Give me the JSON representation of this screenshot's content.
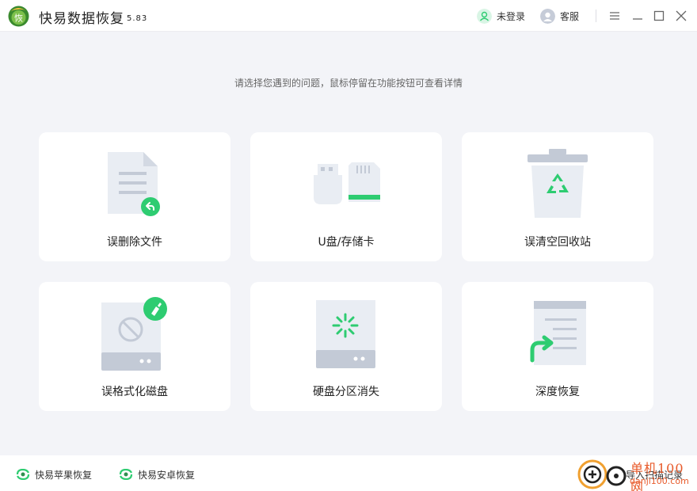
{
  "app": {
    "title": "快易数据恢复",
    "version": "5.83",
    "logo_text": "恢"
  },
  "header": {
    "login_label": "未登录",
    "service_label": "客服"
  },
  "hint": "请选择您遇到的问题，鼠标停留在功能按钮可查看详情",
  "cards": [
    {
      "label": "误删除文件",
      "icon": "deleted-file-icon"
    },
    {
      "label": "U盘/存储卡",
      "icon": "usb-sdcard-icon"
    },
    {
      "label": "误清空回收站",
      "icon": "recycle-bin-icon"
    },
    {
      "label": "误格式化磁盘",
      "icon": "formatted-disk-icon"
    },
    {
      "label": "硬盘分区消失",
      "icon": "lost-partition-icon"
    },
    {
      "label": "深度恢复",
      "icon": "deep-recovery-icon"
    }
  ],
  "footer": {
    "apple_label": "快易苹果恢复",
    "android_label": "快易安卓恢复",
    "import_label": "导入扫描记录"
  },
  "watermark": {
    "line1": "单机100网",
    "line2": "danji100.com"
  },
  "colors": {
    "accent": "#2ecc71",
    "icon_gray": "#c3cad6",
    "icon_light": "#e9edf3",
    "background": "#f3f4f8"
  }
}
